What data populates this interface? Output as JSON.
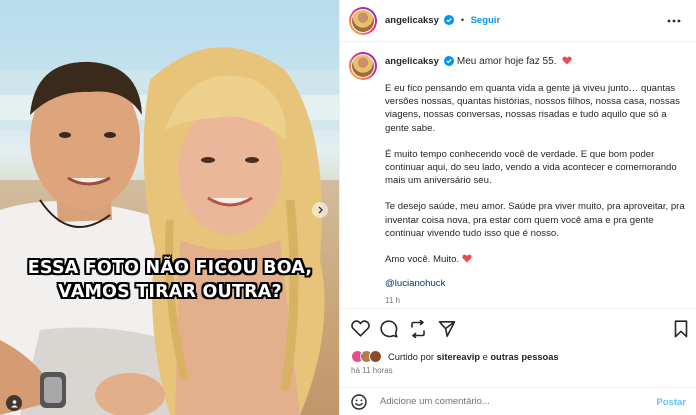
{
  "post": {
    "username": "angelicaksy",
    "follow_label": "Seguir",
    "dot": "•",
    "image_caption_lines": [
      "ESSA FOTO NÃO FICOU BOA,",
      "VAMOS TIRAR OUTRA?"
    ],
    "caption_first": "Meu amor hoje faz 55.",
    "paragraphs": [
      "E eu fico pensando em quanta vida a gente já viveu junto… quantas versões nossas, quantas histórias, nossos filhos, nossa casa, nossas viagens, nossas conversas, nossas risadas e tudo aquilo que só a gente sabe.",
      "É muito tempo conhecendo você de verdade. E que bom poder continuar aqui, do seu lado, vendo a vida acontecer e comemorando mais um aniversário seu.",
      "Te desejo saúde, meu amor. Saúde pra viver muito, pra aproveitar, pra inventar coisa nova, pra estar com quem você ama e pra gente continuar vivendo tudo isso que é nosso."
    ],
    "closing": "Amo você. Muito.",
    "mention": "@lucianohuck",
    "caption_time": "11 h",
    "likes": {
      "prefix": "Curtido por",
      "user": "sitereavip",
      "connector": "e",
      "others": "outras pessoas"
    },
    "time_ago": "há 11 horas",
    "comment_placeholder": "Adicione um comentário...",
    "post_label": "Postar"
  },
  "icons": {
    "verified": "verified-badge-icon",
    "more": "more-options-icon",
    "heart": "heart-icon",
    "comment": "comment-icon",
    "share": "share-icon",
    "send": "send-icon",
    "save": "bookmark-icon",
    "emoji": "emoji-icon",
    "next": "chevron-right-icon",
    "tag": "user-tag-icon"
  },
  "colors": {
    "accent": "#0095f6",
    "mention": "#00376b",
    "heart_emoji": "#ed4956",
    "verified": "#0095f6"
  }
}
